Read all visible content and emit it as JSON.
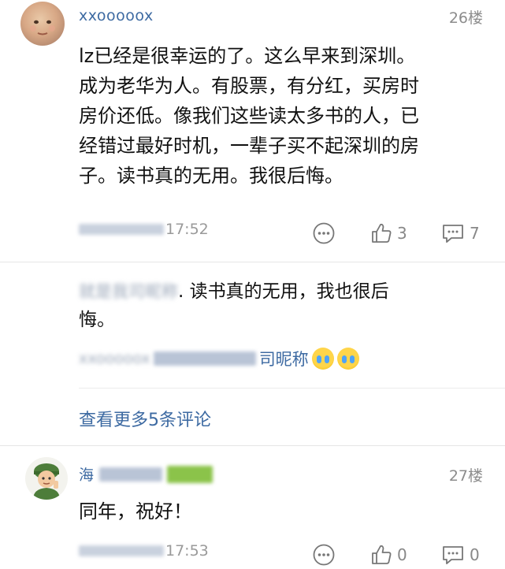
{
  "comment1": {
    "username": "xxooooox",
    "floor": "26楼",
    "lines": [
      "lz已经是很幸运的了。这么早来到深圳。",
      "成为老华为人。有股票，有分红，买房时",
      "房价还低。像我们这些读太多书的人，已",
      "经错过最好时机，一辈子买不起深圳的房",
      "子。读书真的无用。我很后悔。"
    ],
    "time_visible": "17:52",
    "likes": "3",
    "replies_count": "7"
  },
  "reply": {
    "author_visible": "就是我司昵称",
    "text_line1": ". 读书真的无用，我也很后",
    "text_line2": "悔。",
    "meta_visible_prefix": "xxooooox",
    "meta_visible_suffix": "司昵称"
  },
  "more_link": "查看更多5条评论",
  "comment2": {
    "username_visible": "海",
    "floor": "27楼",
    "text": "同年，祝好！",
    "time_visible": "17:53",
    "likes": "0",
    "replies_count": "0"
  },
  "icons": {
    "more": "more-dots-icon",
    "like": "thumbs-up-icon",
    "comment": "comment-bubble-icon",
    "emoji": "crying-emoji-icon"
  },
  "colors": {
    "username": "#3d6aa2",
    "link": "#3d6aa2",
    "meta": "#9a9a9a"
  }
}
